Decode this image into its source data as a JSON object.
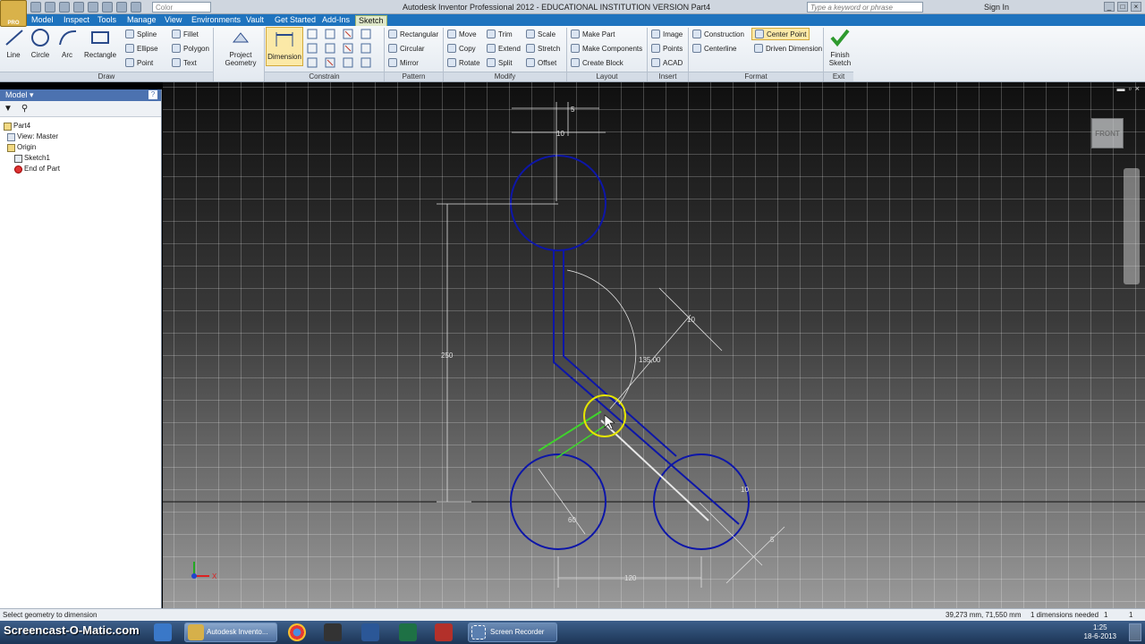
{
  "app": {
    "title": "Autodesk Inventor Professional 2012 - EDUCATIONAL INSTITUTION VERSION   Part4",
    "color_placeholder": "Color",
    "search_placeholder": "Type a keyword or phrase",
    "sign_in": "Sign In",
    "logo_text": "PRO"
  },
  "tabs": [
    "Model",
    "Inspect",
    "Tools",
    "Manage",
    "View",
    "Environments",
    "Vault",
    "Get Started",
    "Add-Ins",
    "Sketch"
  ],
  "active_tab": "Sketch",
  "ribbon": {
    "draw": {
      "label": "Draw",
      "big": [
        "Line",
        "Circle",
        "Arc",
        "Rectangle"
      ],
      "small": [
        "Spline",
        "Ellipse",
        "Point",
        "Fillet",
        "Polygon",
        "Text"
      ]
    },
    "project_geometry": "Project Geometry",
    "constrain": {
      "label": "Constrain",
      "dimension": "Dimension"
    },
    "pattern": {
      "label": "Pattern",
      "items": [
        "Rectangular",
        "Circular",
        "Mirror"
      ]
    },
    "modify": {
      "label": "Modify",
      "items": [
        "Move",
        "Copy",
        "Rotate",
        "Trim",
        "Extend",
        "Split",
        "Scale",
        "Stretch",
        "Offset"
      ]
    },
    "layout": {
      "label": "Layout",
      "items": [
        "Make Part",
        "Make Components",
        "Create Block"
      ]
    },
    "insert": {
      "label": "Insert",
      "items": [
        "Image",
        "Points",
        "ACAD"
      ]
    },
    "format": {
      "label": "Format",
      "items": [
        "Construction",
        "Centerline",
        "Center Point",
        "Driven Dimension"
      ]
    },
    "exit": {
      "label": "Exit",
      "finish": "Finish Sketch"
    }
  },
  "browser": {
    "title": "Model",
    "tree": [
      "Part4",
      "View: Master",
      "Origin",
      "Sketch1",
      "End of Part"
    ]
  },
  "viewport": {
    "viewcube_label": "FRONT",
    "axis_x": "X",
    "dims": {
      "d5_top": "5",
      "d10_top": "10",
      "d250": "250",
      "angle": "135,00",
      "d10_diag": "10",
      "d60": "60",
      "d10_right": "10",
      "d5_right": "5",
      "d120": "120"
    }
  },
  "status": {
    "prompt": "Select geometry to dimension",
    "coords": "39,273 mm, 71,550 mm",
    "dims_needed": "1 dimensions needed",
    "num1": "1",
    "num2": "1"
  },
  "taskbar": {
    "watermark": "Screencast-O-Matic.com",
    "items": [
      "Autodesk Invento...",
      "Screen Recorder"
    ],
    "time": "1:25",
    "date": "18-6-2013"
  }
}
